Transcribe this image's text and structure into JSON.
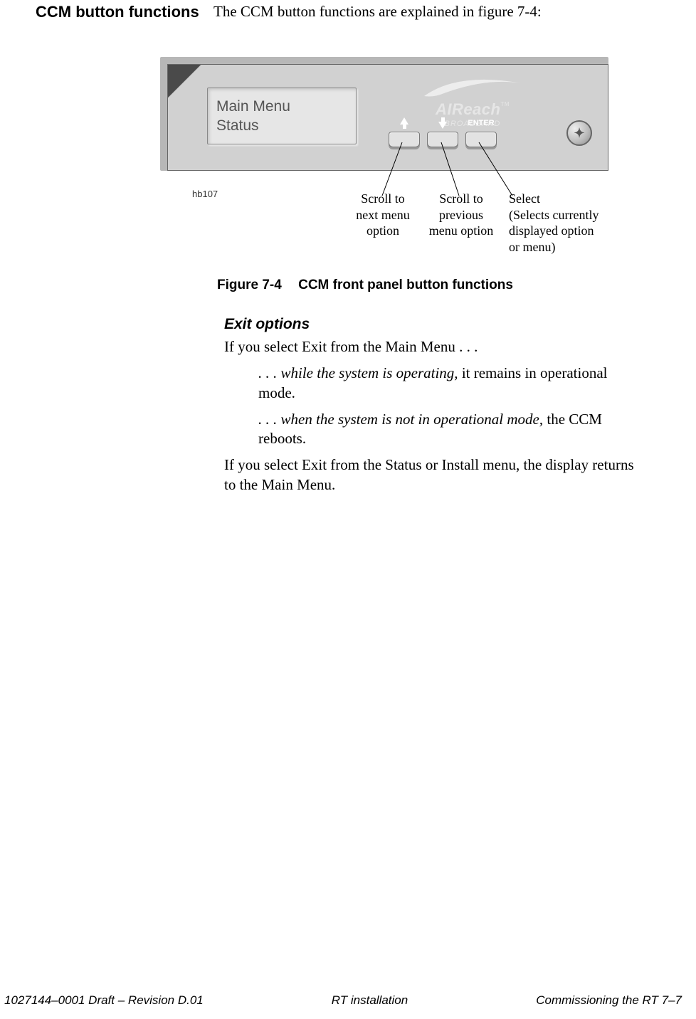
{
  "header": {
    "section_title": "CCM button functions",
    "intro": "The CCM button functions are explained in figure 7-4:"
  },
  "figure": {
    "id_label": "hb107",
    "lcd_line1": "Main Menu",
    "lcd_line2": "Status",
    "logo_title": "AIReach",
    "logo_tm": "TM",
    "logo_sub": "BROADBAND",
    "enter_label": "ENTER",
    "callouts": {
      "up": "Scroll to\nnext menu\noption",
      "down": "Scroll to\nprevious\nmenu option",
      "enter": "Select\n(Selects currently\ndisplayed option\nor menu)"
    },
    "caption_num": "Figure  7-4",
    "caption_text": "CCM front panel button functions"
  },
  "exit": {
    "heading": "Exit options",
    "p1": "If you select Exit from the Main Menu . . .",
    "bullet1_ital": ". . . while the system is operating,",
    "bullet1_rest": " it remains in operational mode.",
    "bullet2_ital": ". . . when the system is not in operational mode,",
    "bullet2_rest": " the CCM reboots.",
    "p2": "If you select Exit from the Status or Install menu, the display returns to the Main Menu."
  },
  "footer": {
    "left": "1027144–0001  Draft – Revision D.01",
    "center": "RT installation",
    "right": "Commissioning the RT   7–7"
  }
}
